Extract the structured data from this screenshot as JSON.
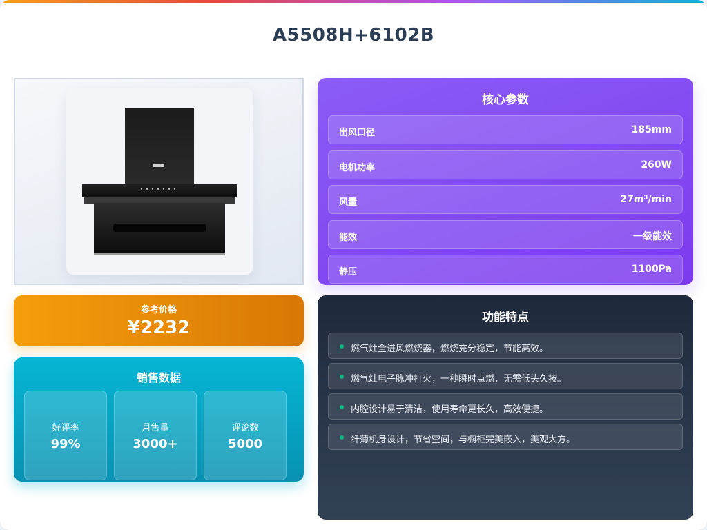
{
  "product": {
    "title": "A5508H+6102B"
  },
  "price": {
    "label": "参考价格",
    "value": "¥2232"
  },
  "sales": {
    "title": "销售数据",
    "stats": [
      {
        "label": "好评率",
        "value": "99%"
      },
      {
        "label": "月售量",
        "value": "3000+"
      },
      {
        "label": "评论数",
        "value": "5000"
      }
    ]
  },
  "specs": {
    "title": "核心参数",
    "rows": [
      {
        "label": "出风口径",
        "value": "185mm"
      },
      {
        "label": "电机功率",
        "value": "260W"
      },
      {
        "label": "风量",
        "value": "27m³/min"
      },
      {
        "label": "能效",
        "value": "一级能效"
      },
      {
        "label": "静压",
        "value": "1100Pa"
      }
    ]
  },
  "features": {
    "title": "功能特点",
    "items": [
      "燃气灶全进风燃烧器，燃烧充分稳定，节能高效。",
      "燃气灶电子脉冲打火，一秒瞬时点燃，无需低头久按。",
      "内腔设计易于清洁，使用寿命更长久，高效便捷。",
      "纤薄机身设计，节省空间，与橱柜完美嵌入，美观大方。"
    ]
  },
  "colors": {
    "price_accent": "#f59e0b",
    "sales_accent": "#06b6d4",
    "spec_accent": "#8b5cf6",
    "feature_bg": "#1e293b",
    "feature_dot": "#10b981",
    "title_text": "#2c3e55"
  }
}
